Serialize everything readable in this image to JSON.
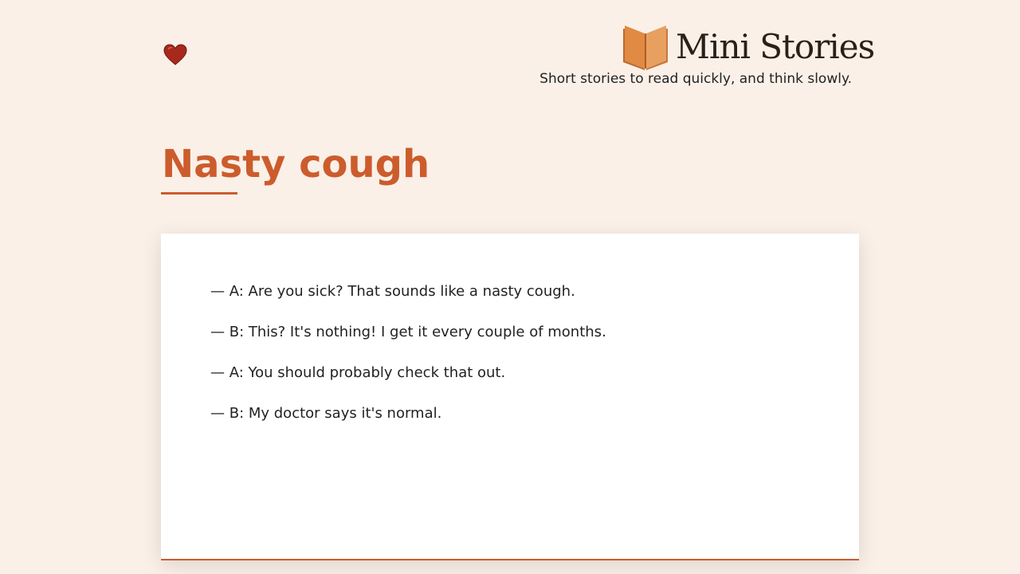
{
  "header": {
    "heart_icon": "heart-icon",
    "brand_icon": "open-book-icon",
    "brand_name": "Mini Stories",
    "tagline": "Short stories to read quickly, and think slowly."
  },
  "story": {
    "title": "Nasty cough",
    "lines": [
      "— A: Are you sick? That sounds like a nasty cough.",
      "— B: This? It's nothing! I get it every couple of months.",
      "— A: You should probably check that out.",
      "— B: My doctor says it's normal."
    ]
  },
  "colors": {
    "background": "#faf0e8",
    "accent": "#cc5c2c",
    "card": "#ffffff"
  }
}
